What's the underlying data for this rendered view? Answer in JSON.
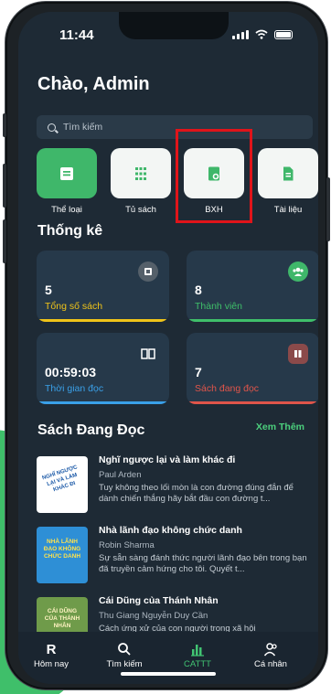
{
  "status": {
    "time": "11:44"
  },
  "greeting": "Chào, Admin",
  "search": {
    "placeholder": "Tìm kiếm"
  },
  "categories": [
    {
      "label": "Thể loại",
      "icon": "list-doc-icon"
    },
    {
      "label": "Tủ sách",
      "icon": "grid-shelf-icon"
    },
    {
      "label": "BXH",
      "icon": "ranking-doc-icon"
    },
    {
      "label": "Tài liệu",
      "icon": "document-icon"
    }
  ],
  "stats_title": "Thống kê",
  "stats": [
    {
      "value": "5",
      "caption": "Tổng số sách",
      "color": "#f0c419",
      "icon": "book-icon"
    },
    {
      "value": "8",
      "caption": "Thành viên",
      "color": "#3fbf6a",
      "icon": "members-icon"
    },
    {
      "value": "00:59:03",
      "caption": "Thời gian đọc",
      "color": "#3aa0e8",
      "icon": "open-book-icon"
    },
    {
      "value": "7",
      "caption": "Sách đang đọc",
      "color": "#e0554a",
      "icon": "reading-book-icon"
    }
  ],
  "reading": {
    "title": "Sách Đang Đọc",
    "more": "Xem Thêm",
    "books": [
      {
        "title": "Nghĩ ngược lại và làm khác đi",
        "author": "Paul Arden",
        "desc": "Tuy không theo lối mòn là con đường đúng đắn để dành chiến thắng hãy bắt đầu con đường t...",
        "cover_text": "NGHĨ NGƯỢC LẠI VÀ LÀM KHÁC ĐI"
      },
      {
        "title": "Nhà lãnh đạo không chức danh",
        "author": "Robin Sharma",
        "desc": "Sự sẵn sàng đánh thức người lãnh đạo bên trong bạn đã truyền cảm hứng cho tôi. Quyết t...",
        "cover_text": "NHÀ LÃNH ĐẠO KHÔNG CHỨC DANH"
      },
      {
        "title": "Cái Dũng của Thánh Nhân",
        "author": "Thu Giang Nguyễn Duy Cần",
        "desc": "Cách ứng xử của con người trong xã hội",
        "cover_text": "CÁI DŨNG CỦA THÁNH NHÂN"
      }
    ]
  },
  "nav": [
    {
      "label": "Hôm nay",
      "glyph": "R"
    },
    {
      "label": "Tìm kiếm",
      "glyph": "search"
    },
    {
      "label": "CATTT",
      "glyph": "bars"
    },
    {
      "label": "Cá nhân",
      "glyph": "user"
    }
  ],
  "colors": {
    "accent": "#41c472",
    "highlight": "#e0141a",
    "background": "#1e2a35"
  }
}
